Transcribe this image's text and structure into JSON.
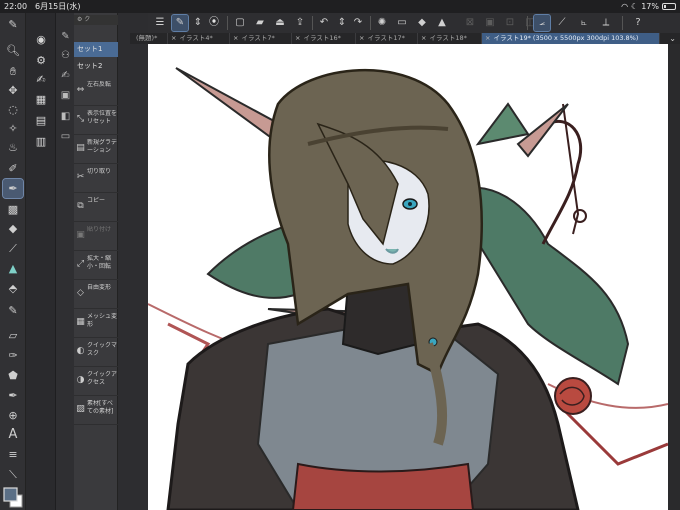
{
  "status_bar": {
    "time": "22:00",
    "date": "6月15日(水)",
    "battery": "17%"
  },
  "palette": {
    "sets": [
      "セット1",
      "セット2"
    ],
    "items": [
      {
        "icon": "flip-icon",
        "glyph": "⇔",
        "label": "左右反転"
      },
      {
        "icon": "position-icon",
        "glyph": "⤡",
        "label": "表示位置をリセット"
      },
      {
        "icon": "gradient-icon",
        "glyph": "▤",
        "label": "新規グラデーション"
      },
      {
        "icon": "scissors-icon",
        "glyph": "✂",
        "label": "切り取り"
      },
      {
        "icon": "copy-icon",
        "glyph": "⧉",
        "label": "コピー"
      },
      {
        "icon": "paste-icon",
        "glyph": "▣",
        "label": "貼り付け"
      },
      {
        "icon": "scale-icon",
        "glyph": "⤢",
        "label": "拡大・縮小・回転"
      },
      {
        "icon": "free-transform-icon",
        "glyph": "◇",
        "label": "自由変形"
      },
      {
        "icon": "mesh-icon",
        "glyph": "▦",
        "label": "メッシュ変形"
      },
      {
        "icon": "quick-mask-icon",
        "glyph": "◐",
        "label": "クイックマスク"
      },
      {
        "icon": "quick-select-icon",
        "glyph": "◑",
        "label": "クイックアクセス"
      },
      {
        "icon": "materials-icon",
        "glyph": "▨",
        "label": "素材[すべての素材]"
      }
    ]
  },
  "tabs": [
    {
      "label": "(無題)*",
      "active": false
    },
    {
      "label": "イラスト4*",
      "active": false
    },
    {
      "label": "イラスト7*",
      "active": false
    },
    {
      "label": "イラスト16*",
      "active": false
    },
    {
      "label": "イラスト17*",
      "active": false
    },
    {
      "label": "イラスト18*",
      "active": false
    },
    {
      "label": "イラスト19* (3500 x 5500px 300dpi 103.8%)",
      "active": true
    }
  ],
  "colors": {
    "accent": "#4a6b95",
    "active_tab": "#3f5e86",
    "panel": "#3a3a3d",
    "main_color": "#5b6f86",
    "sub_color": "#ffffff"
  }
}
